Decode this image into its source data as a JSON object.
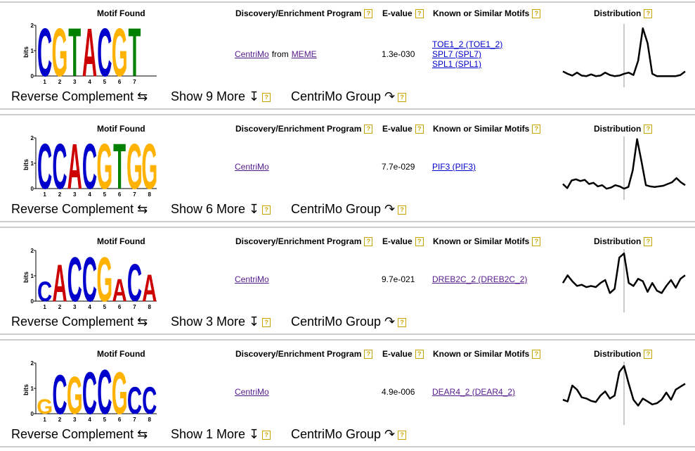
{
  "headers": {
    "motif": "Motif Found",
    "program": "Discovery/Enrichment Program",
    "evalue": "E-value",
    "known": "Known or Similar Motifs",
    "distribution": "Distribution",
    "help_symbol": "?"
  },
  "logo_axis": {
    "label": "bits",
    "ticks": [
      "2",
      "1",
      "0"
    ]
  },
  "actions": {
    "reverse_complement": "Reverse Complement ⇆",
    "show_more_prefix": "Show",
    "show_more_suffix": "More ↧",
    "centrimo_group": "CentriMo Group ↷"
  },
  "motifs": [
    {
      "sequence": "CGTACGT",
      "program": "CentriMo",
      "program_from": "from",
      "program_extra": "MEME",
      "evalue": "1.3e-030",
      "known": [
        "TOE1_2 (TOE1_2)",
        "SPL7 (SPL7)",
        "SPL1 (SPL1)"
      ],
      "show_more_count": "9"
    },
    {
      "sequence": "CCACGTGG",
      "program": "CentriMo",
      "evalue": "7.7e-029",
      "known": [
        "PIF3 (PIF3)"
      ],
      "show_more_count": "6"
    },
    {
      "sequence": "CACCGACA",
      "program": "CentriMo",
      "evalue": "9.7e-021",
      "known": [
        "DREB2C_2 (DREB2C_2)"
      ],
      "show_more_count": "3"
    },
    {
      "sequence": "GCGCCGCC",
      "program": "CentriMo",
      "evalue": "4.9e-006",
      "known": [
        "DEAR4_2 (DEAR4_2)"
      ],
      "show_more_count": "1"
    }
  ]
}
